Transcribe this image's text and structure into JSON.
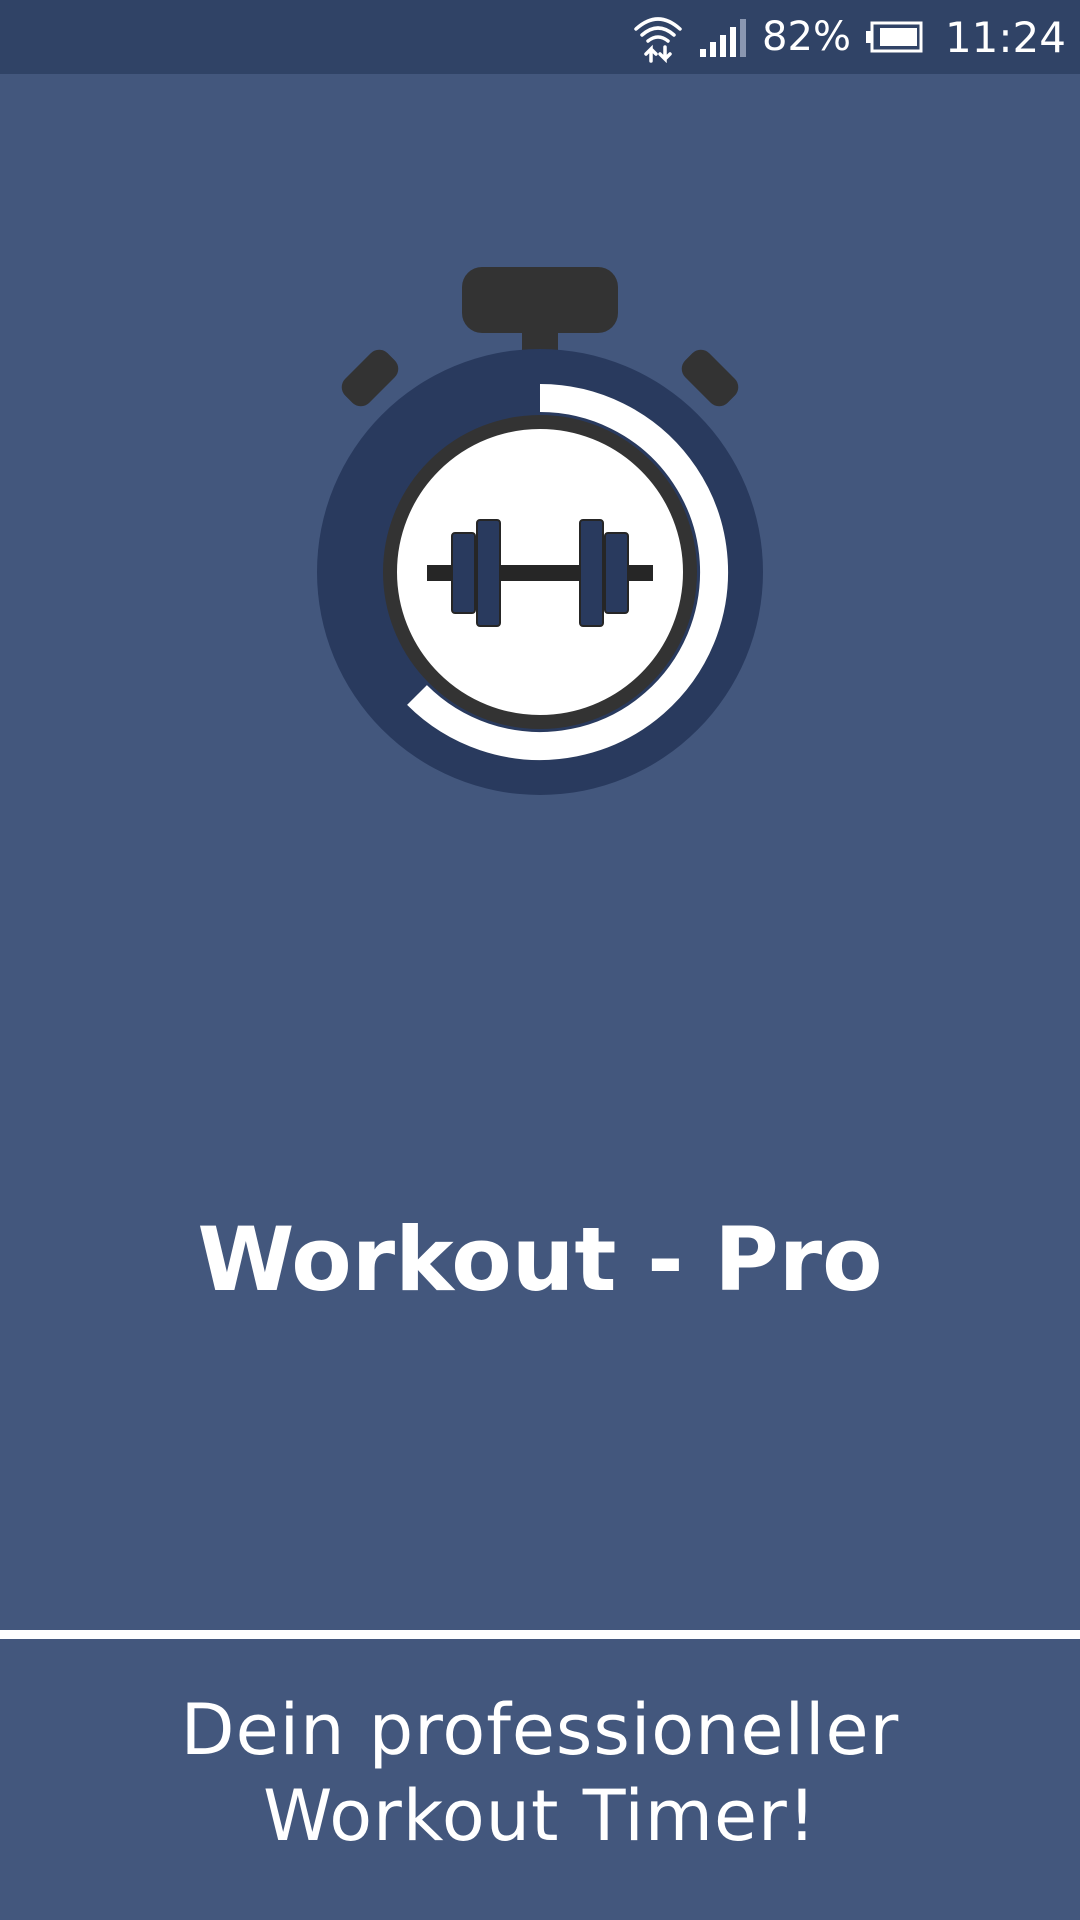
{
  "status_bar": {
    "battery_percent": "82%",
    "time": "11:24",
    "icons": [
      "wifi-data-icon",
      "signal-icon",
      "battery-icon"
    ]
  },
  "splash": {
    "logo_icon": "stopwatch-dumbbell-icon",
    "title": "Workout - Pro",
    "tagline_line1": "Dein professioneller",
    "tagline_line2": "Workout Timer!"
  },
  "colors": {
    "background": "#43577d",
    "status_bar": "#304366",
    "stopwatch_ring": "#293a5e",
    "dark": "#333333",
    "accent_white": "#ffffff"
  }
}
